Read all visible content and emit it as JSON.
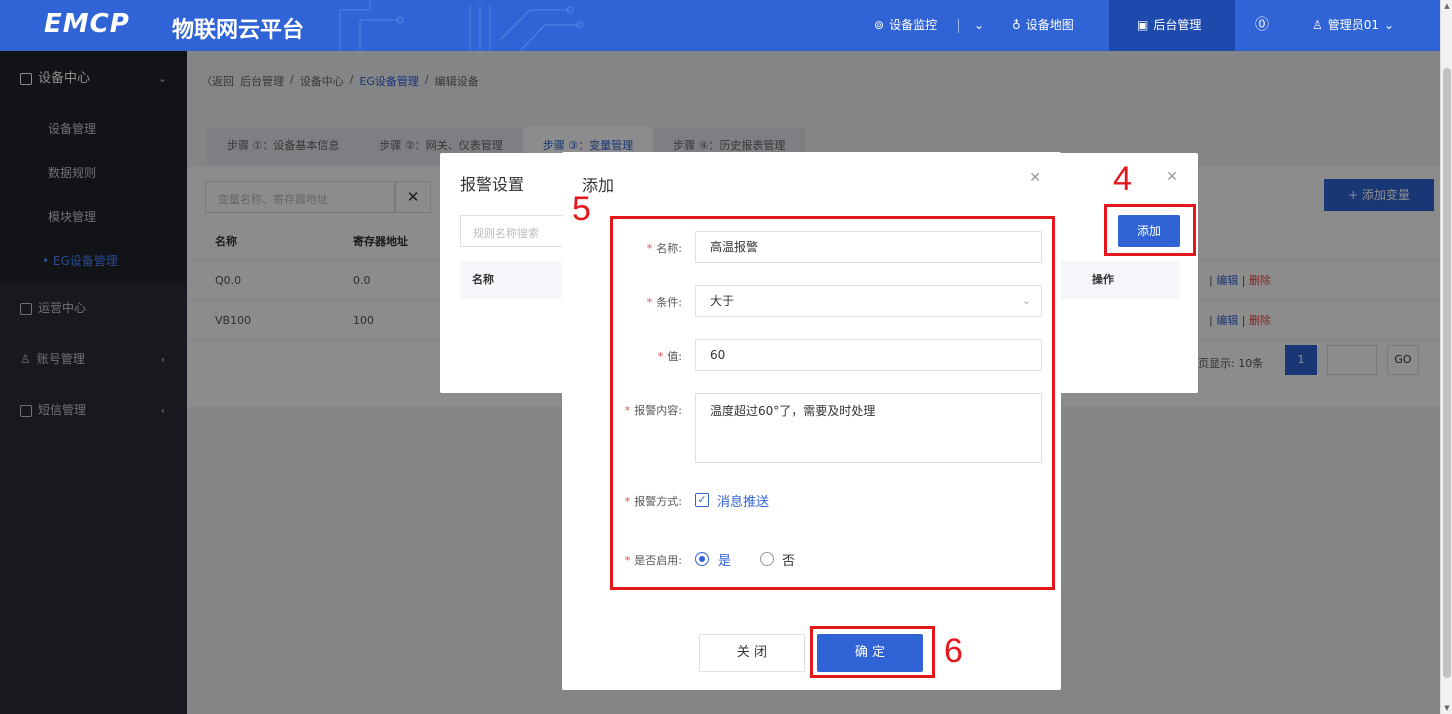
{
  "topbar": {
    "logo": "EMCP",
    "logo_cn": "物联网云平台",
    "nav": [
      {
        "label": "设备监控",
        "icon": "monitor-icon"
      },
      {
        "label": "设备地图",
        "icon": "map-pin-icon"
      },
      {
        "label": "后台管理",
        "icon": "admin-icon",
        "active": true
      },
      {
        "label": "",
        "icon": "help-icon"
      },
      {
        "label": "管理员01",
        "icon": "user-icon"
      }
    ]
  },
  "sidebar": {
    "group": {
      "label": "设备中心",
      "icon": "device-center-icon"
    },
    "subitems": [
      "设备管理",
      "数据规则",
      "模块管理",
      "• EG设备管理"
    ],
    "items": [
      {
        "label": "运营中心",
        "icon": "operations-icon"
      },
      {
        "label": "账号管理",
        "icon": "account-icon"
      },
      {
        "label": "短信管理",
        "icon": "sms-icon"
      }
    ]
  },
  "breadcrumb": {
    "back": "〈返回",
    "items": [
      "后台管理",
      "/",
      "设备中心",
      "/",
      "EG设备管理",
      "/",
      "编辑设备"
    ]
  },
  "steps": [
    "步骤 ①：设备基本信息",
    "步骤 ②：网关、仪表管理",
    "步骤 ③：变量管理",
    "步骤 ④：历史报表管理"
  ],
  "var_table": {
    "search_placeholder": "变量名称、寄存器地址",
    "clear": "✕",
    "add_button": "+ 添加变量",
    "headers": [
      "名称",
      "寄存器地址"
    ],
    "rows": [
      {
        "name": "Q0.0",
        "addr": "0.0"
      },
      {
        "name": "VB100",
        "addr": "100"
      }
    ],
    "edit": "编辑",
    "delete": "删除",
    "pager_label": "每页显示: 10条",
    "page": "1",
    "go": "GO"
  },
  "alarm_dialog": {
    "title": "报警设置",
    "search_placeholder": "规则名称搜索",
    "add_button": "添加",
    "headers": [
      "名称",
      "操作"
    ]
  },
  "add_dialog": {
    "title": "添加",
    "fields": {
      "name": {
        "label": "名称:",
        "value": "高温报警"
      },
      "condition": {
        "label": "条件:",
        "value": "大于"
      },
      "value": {
        "label": "值:",
        "value": "60"
      },
      "content": {
        "label": "报警内容:",
        "value": "温度超过60°了，需要及时处理"
      },
      "method": {
        "label": "报警方式:",
        "option": "消息推送"
      },
      "enabled": {
        "label": "是否启用:",
        "yes": "是",
        "no": "否"
      }
    },
    "close_button": "关 闭",
    "ok_button": "确 定"
  },
  "annotations": {
    "n4": "4",
    "n5": "5",
    "n6": "6",
    "color": "#e3171c"
  },
  "colors": {
    "primary": "#2f63d6",
    "sidebar": "#2b2f3a",
    "danger": "#e64b4b"
  }
}
